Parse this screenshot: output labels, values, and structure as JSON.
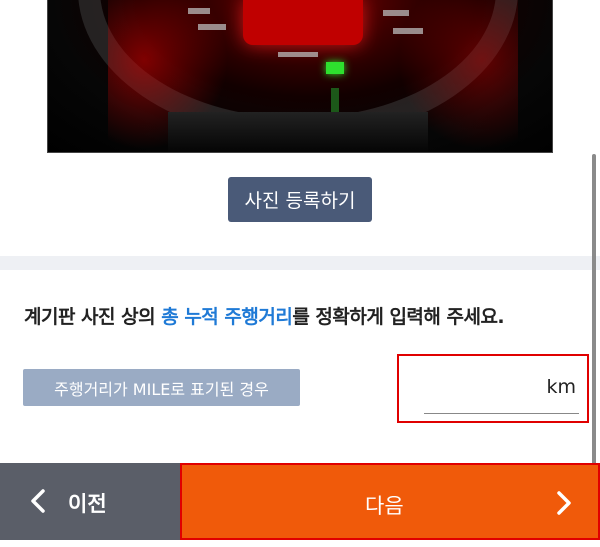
{
  "photo": {
    "alt": "dashboard-photo"
  },
  "upload": {
    "label": "사진 등록하기"
  },
  "instruction": {
    "before": "계기판 사진 상의 ",
    "highlight": "총 누적 주행거리",
    "after": "를 정확하게 입력해 주세요.",
    "highlight_color": "#1f7ad6"
  },
  "mile_button": {
    "label": "주행거리가 MILE로 표기된 경우"
  },
  "mileage": {
    "value": "",
    "unit": "km"
  },
  "footer": {
    "prev_label": "이전",
    "next_label": "다음",
    "prev_icon": "chevron-left-icon",
    "next_icon": "chevron-right-icon",
    "next_color": "#f05a0a",
    "prev_color": "#5a5e68"
  }
}
